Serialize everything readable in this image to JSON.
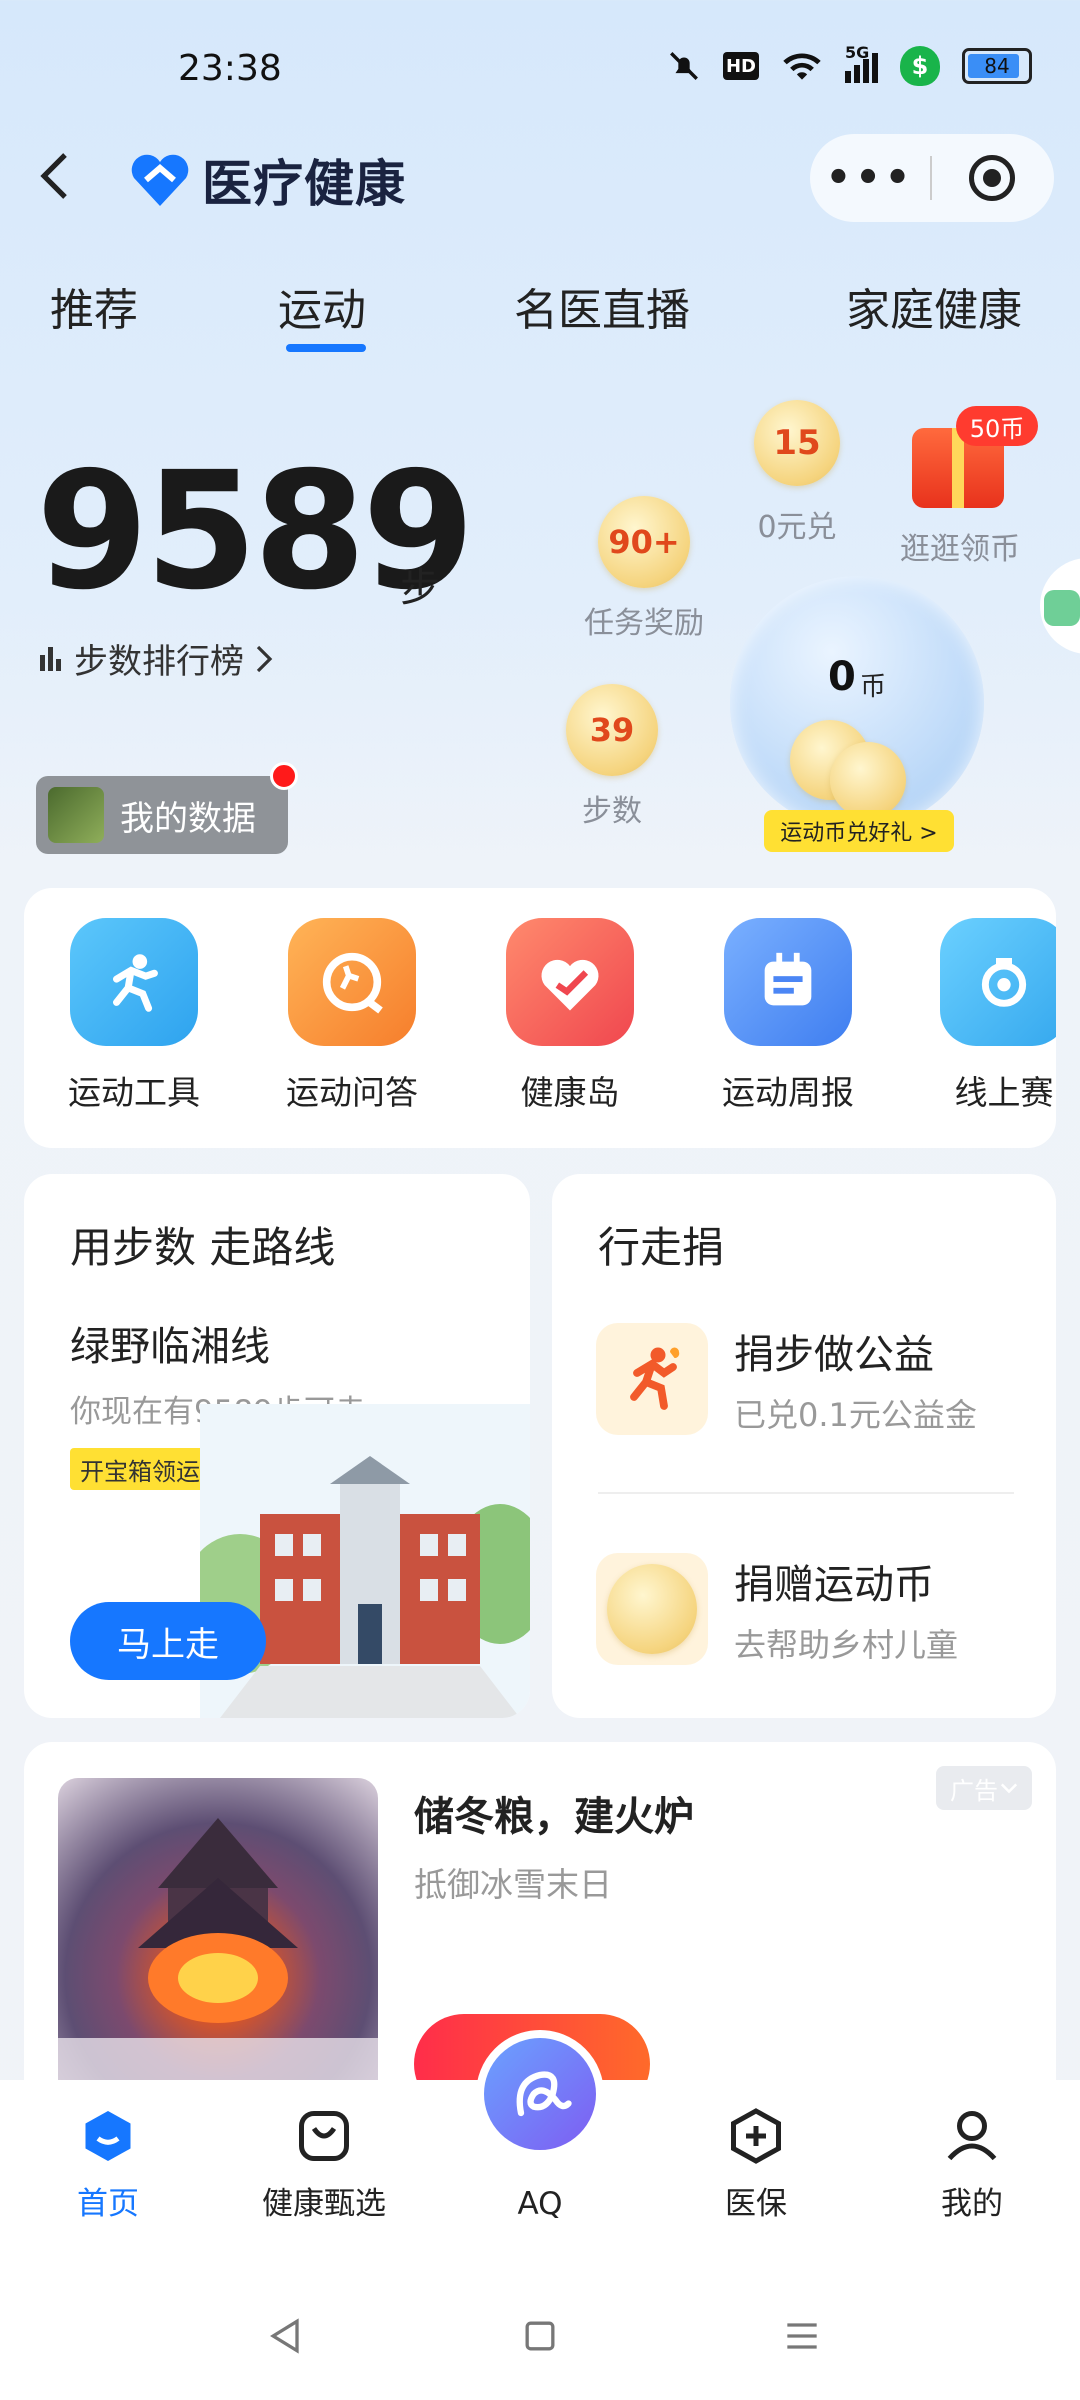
{
  "status_bar": {
    "time": "23:38",
    "battery": "84",
    "net": "5G"
  },
  "header": {
    "title": "医疗健康",
    "more_label": "•••"
  },
  "tabs": [
    {
      "label": "推荐",
      "active": false
    },
    {
      "label": "运动",
      "active": true
    },
    {
      "label": "名医直播",
      "active": false
    },
    {
      "label": "家庭健康",
      "active": false
    }
  ],
  "steps": {
    "count": "9589",
    "unit": "步",
    "rank_label": "步数排行榜",
    "my_data_label": "我的数据"
  },
  "coins": {
    "task_reward": {
      "value": "90+",
      "caption": "任务奖励"
    },
    "zero_redeem": {
      "value": "15",
      "caption": "0元兑"
    },
    "browse": {
      "badge": "50币",
      "caption": "逛逛领币"
    },
    "steps_coin": {
      "value": "39",
      "caption": "步数"
    },
    "balance": {
      "value": "0",
      "unit": "币",
      "redeem_label": "运动币兑好礼 >"
    }
  },
  "tools": [
    {
      "label": "运动工具",
      "icon": "running-person-icon",
      "color": "#39b3f5"
    },
    {
      "label": "运动问答",
      "icon": "sport-qa-icon",
      "color": "#f98a3a"
    },
    {
      "label": "健康岛",
      "icon": "heart-icon",
      "color": "#f25a55"
    },
    {
      "label": "运动周报",
      "icon": "weekly-report-icon",
      "color": "#4b86f5"
    },
    {
      "label": "线上赛",
      "icon": "online-race-icon",
      "color": "#49b7f2"
    }
  ],
  "route_card": {
    "title": "用步数 走路线",
    "route_name": "绿野临湘线",
    "subtitle": "你现在有9589步可走",
    "treasure_label": "开宝箱领运动币",
    "go_label": "马上走"
  },
  "donate_card": {
    "title": "行走捐",
    "items": [
      {
        "name": "捐步做公益",
        "sub": "已兑0.1元公益金"
      },
      {
        "name": "捐赠运动币",
        "sub": "去帮助乡村儿童"
      }
    ]
  },
  "ad_card": {
    "title": "储冬粮，建火炉",
    "subtitle": "抵御冰雪末日",
    "tag": "广告"
  },
  "bottom_nav": [
    {
      "label": "首页",
      "icon": "home-icon",
      "active": true
    },
    {
      "label": "健康甄选",
      "icon": "shopping-bag-icon",
      "active": false
    },
    {
      "label": "AQ",
      "icon": "aq-icon",
      "active": false
    },
    {
      "label": "医保",
      "icon": "medical-insurance-icon",
      "active": false
    },
    {
      "label": "我的",
      "icon": "profile-icon",
      "active": false
    }
  ],
  "colors": {
    "accent": "#1677ff",
    "coin_text": "#e0481c",
    "tag_yellow": "#ffe033"
  }
}
